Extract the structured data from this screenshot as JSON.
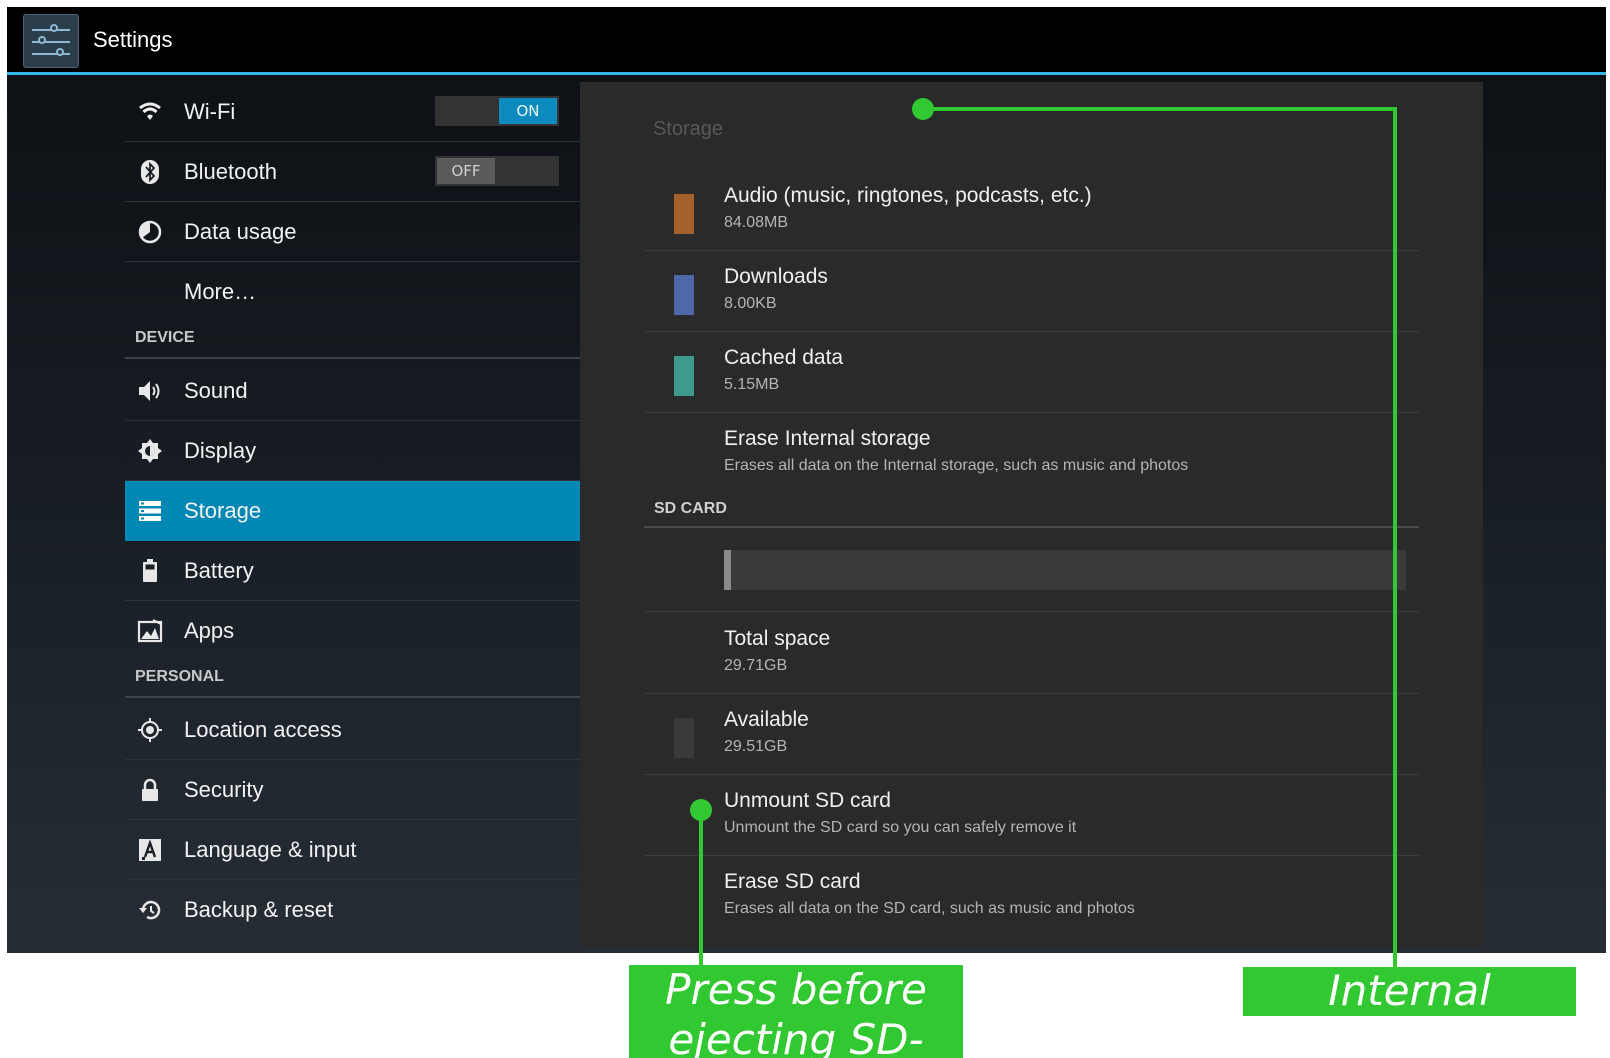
{
  "window": {
    "title": "Settings",
    "icon": "settings-sliders-icon"
  },
  "sidebar": {
    "items": [
      {
        "label": "Wi-Fi",
        "icon": "wifi-icon",
        "toggle": "ON"
      },
      {
        "label": "Bluetooth",
        "icon": "bluetooth-icon",
        "toggle": "OFF"
      },
      {
        "label": "Data usage",
        "icon": "data-usage-icon"
      },
      {
        "label": "More…"
      }
    ],
    "device_header": "DEVICE",
    "device_items": [
      {
        "label": "Sound",
        "icon": "speaker-icon"
      },
      {
        "label": "Display",
        "icon": "display-brightness-icon"
      },
      {
        "label": "Storage",
        "icon": "storage-icon",
        "selected": true
      },
      {
        "label": "Battery",
        "icon": "battery-icon"
      },
      {
        "label": "Apps",
        "icon": "apps-icon"
      }
    ],
    "personal_header": "PERSONAL",
    "personal_items": [
      {
        "label": "Location access",
        "icon": "location-icon"
      },
      {
        "label": "Security",
        "icon": "lock-icon"
      },
      {
        "label": "Language & input",
        "icon": "language-icon"
      },
      {
        "label": "Backup & reset",
        "icon": "backup-icon"
      }
    ]
  },
  "storage": {
    "title": "Storage",
    "internal_rows": [
      {
        "title": "Audio (music, ringtones, podcasts, etc.)",
        "sub": "84.08MB",
        "color": "#a55f2a"
      },
      {
        "title": "Downloads",
        "sub": "8.00KB",
        "color": "#4f69a8"
      },
      {
        "title": "Cached data",
        "sub": "5.15MB",
        "color": "#3f9a8e"
      },
      {
        "title": "Erase Internal storage",
        "sub": "Erases all data on the Internal storage, such as music and photos"
      }
    ],
    "sd_header": "SD CARD",
    "sd_used_fraction": 0.01,
    "sd_rows": [
      {
        "title": "Total space",
        "sub": "29.71GB"
      },
      {
        "title": "Available",
        "sub": "29.51GB",
        "color": "#3a3a3a"
      },
      {
        "title": "Unmount SD card",
        "sub": "Unmount the SD card so you can safely remove it"
      },
      {
        "title": "Erase SD card",
        "sub": "Erases all data on the SD card, such as music and photos"
      }
    ]
  },
  "annotations": {
    "sd_callout": "Press before ejecting SD-card",
    "internal_callout": "Internal storage",
    "color": "#32c832"
  }
}
